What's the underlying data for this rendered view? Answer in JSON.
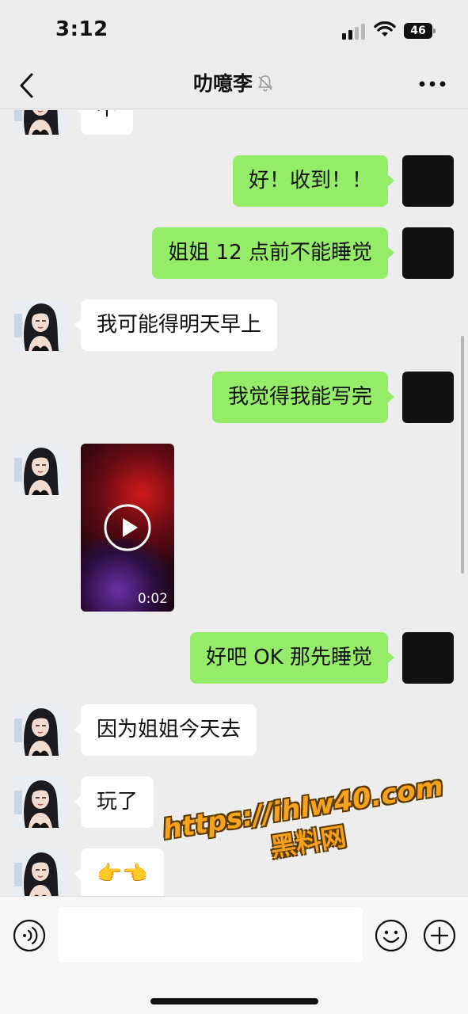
{
  "status_bar": {
    "time": "3:12",
    "battery": "46"
  },
  "header": {
    "title": "叻噫李",
    "mute_icon": "bell-slash-icon",
    "back_icon": "chevron-left-icon",
    "more_icon": "ellipsis-icon"
  },
  "messages": [
    {
      "side": "left",
      "text": "不"
    },
    {
      "side": "right",
      "text": "好！收到！！"
    },
    {
      "side": "right",
      "text": "姐姐 12 点前不能睡觉"
    },
    {
      "side": "left",
      "text": "我可能得明天早上"
    },
    {
      "side": "right",
      "text": "我觉得我能写完"
    },
    {
      "side": "left",
      "type": "video",
      "duration": "0:02"
    },
    {
      "side": "right",
      "text": "好吧 OK 那先睡觉"
    },
    {
      "side": "left",
      "text": "因为姐姐今天去"
    },
    {
      "side": "left",
      "text": "玩了"
    },
    {
      "side": "left",
      "text": "👉👈"
    }
  ],
  "watermark": {
    "url": "https://ihlw40.com",
    "sub": "黑料网"
  },
  "input_bar": {
    "placeholder": "",
    "voice_icon": "voice-icon",
    "emoji_icon": "smiley-icon",
    "add_icon": "plus-circle-icon"
  },
  "colors": {
    "background": "#ededed",
    "sent_bubble": "#95ec69",
    "received_bubble": "#ffffff",
    "watermark": "#f7a21c"
  }
}
